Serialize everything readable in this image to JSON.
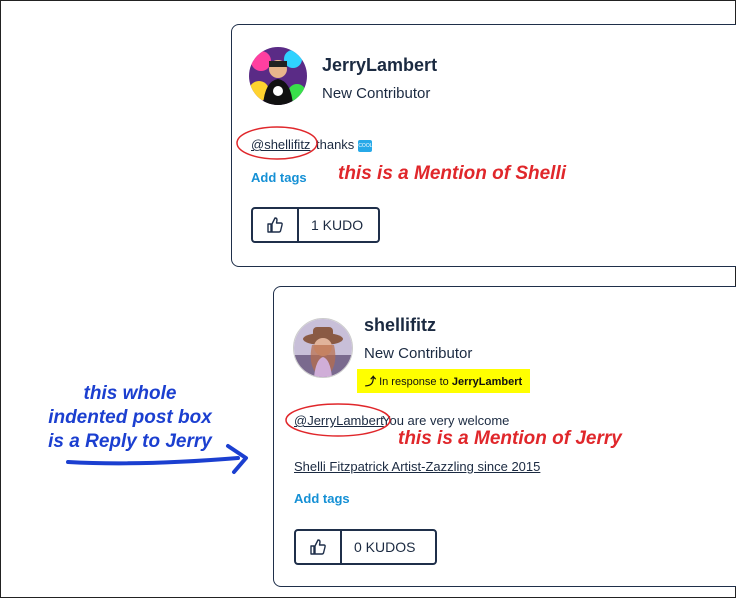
{
  "post1": {
    "username": "JerryLambert",
    "rank": "New Contributor",
    "mention": "@shellifitz",
    "body_text": "thanks",
    "emoji_label": "COOL",
    "add_tags": "Add tags",
    "kudos_label": "1 KUDO"
  },
  "post2": {
    "username": "shellifitz",
    "rank": "New Contributor",
    "in_response_prefix": "In response to",
    "in_response_user": "JerryLambert",
    "mention": "@JerryLambert",
    "body_text": "You are very welcome",
    "signature": "Shelli Fitzpatrick Artist-Zazzling since 2015",
    "add_tags": "Add tags",
    "kudos_label": "0 KUDOS"
  },
  "annotations": {
    "mention_shelli": "this is a Mention of Shelli",
    "mention_jerry": "this is a Mention of Jerry",
    "reply_note_lines": [
      "this whole",
      "indented post box",
      "is a Reply to Jerry"
    ]
  },
  "colors": {
    "border": "#1f2f4a",
    "link_blue": "#1590d5",
    "annotation_red": "#e0272b",
    "annotation_blue": "#1b3fd0",
    "highlight": "#ffff00"
  }
}
